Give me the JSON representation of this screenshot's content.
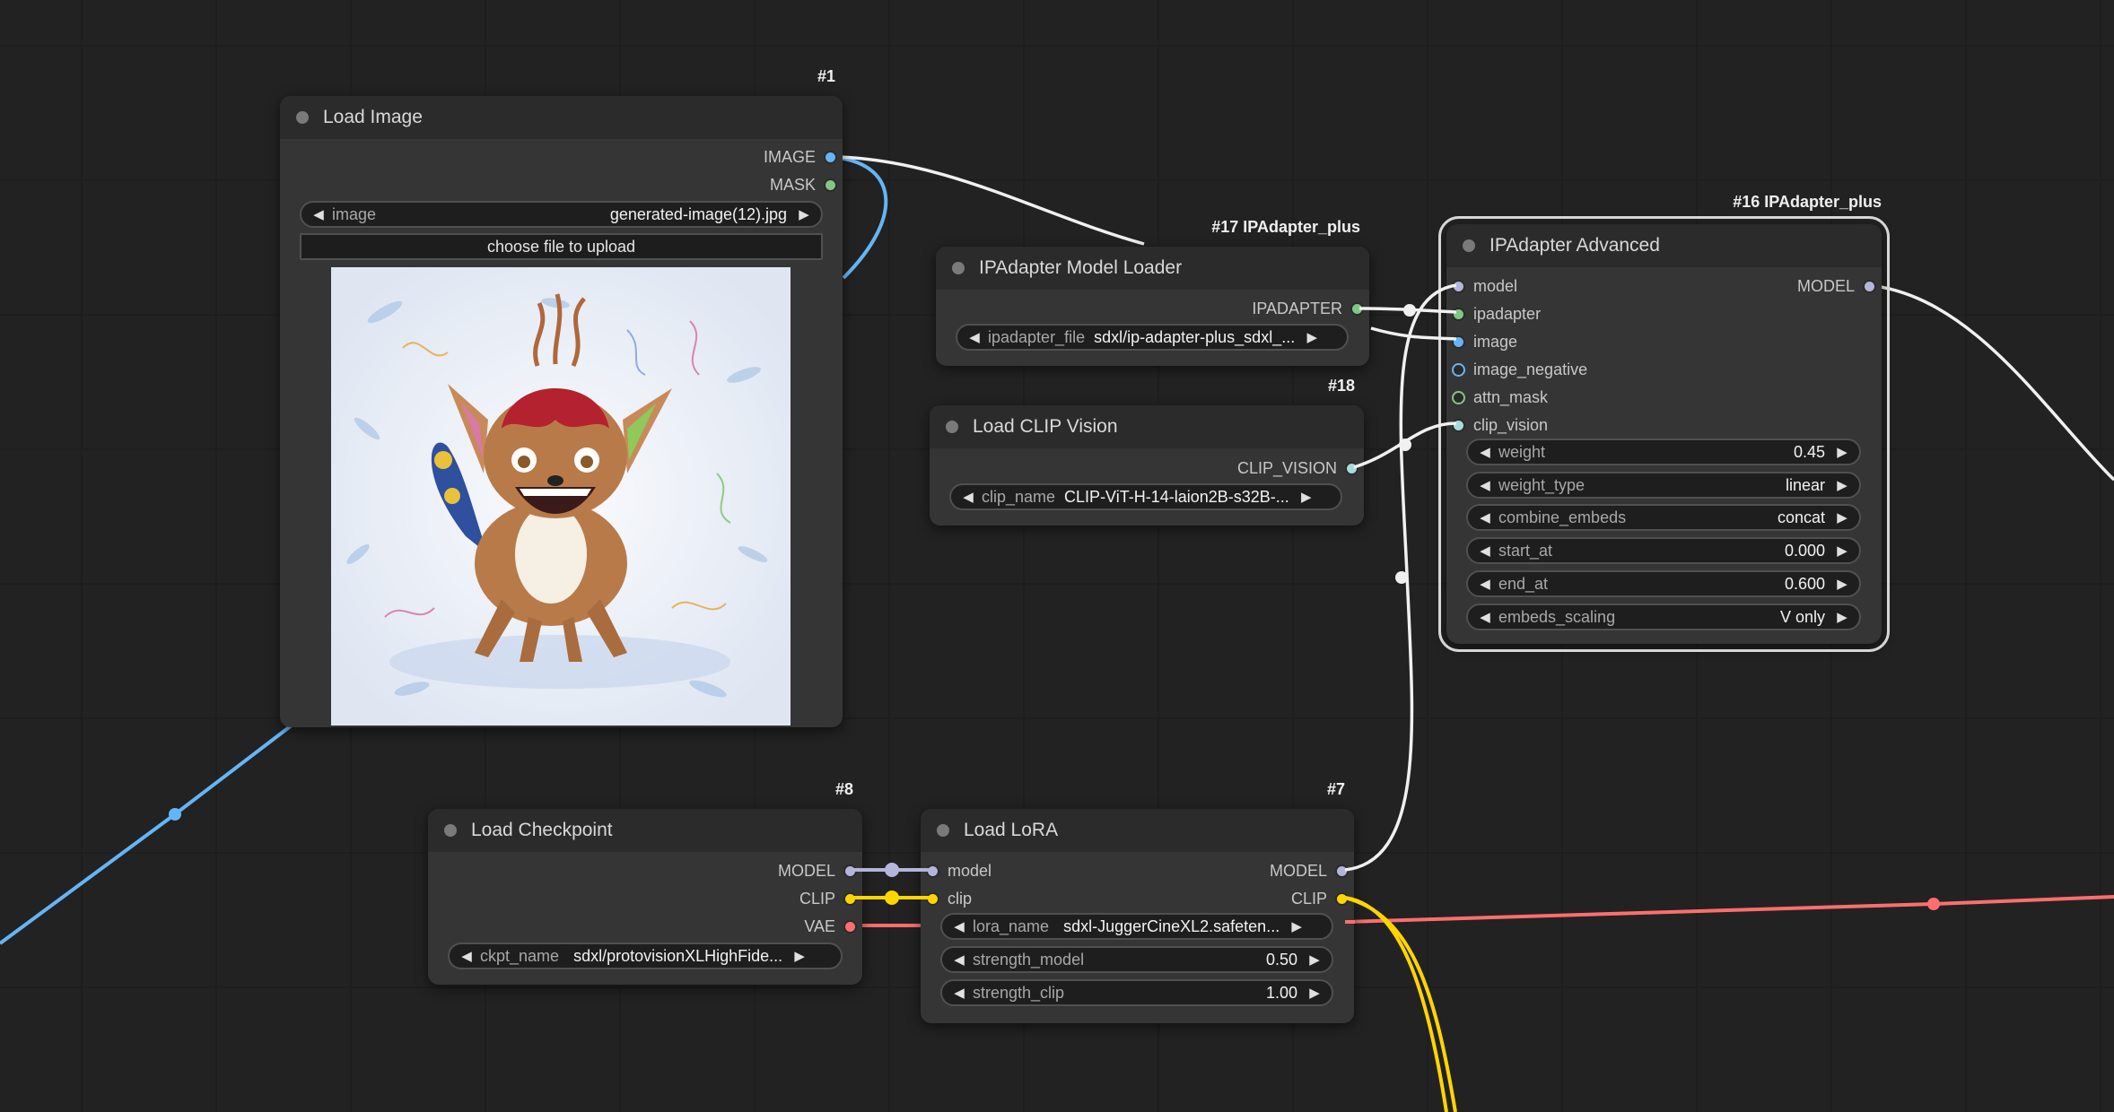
{
  "colors": {
    "canvas": "#222222",
    "node_body": "#353535",
    "node_header": "#2b2b2b",
    "wire_model": "#b4b4dc",
    "wire_clip": "#ffd500",
    "wire_vae": "#ff6e6e",
    "wire_image": "#64b5f6",
    "wire_white": "#f0f0f0",
    "slot_image": "#64b5f6",
    "slot_mask": "#81c784",
    "slot_model": "#b4b4dc",
    "slot_clip": "#ffd500",
    "slot_vae": "#ff6e6e",
    "slot_clip_vision": "#a8dadc",
    "slot_ipadapter": "#81c784"
  },
  "nodes": {
    "load_image": {
      "id_label": "#1",
      "title": "Load Image",
      "outputs": [
        "IMAGE",
        "MASK"
      ],
      "widget": {
        "label": "image",
        "value": "generated-image(12).jpg"
      },
      "button": "choose file to upload",
      "preview_icon": "creature-drawing-image"
    },
    "ipadapter_loader": {
      "id_label": "#17 IPAdapter_plus",
      "title": "IPAdapter Model Loader",
      "output": "IPADAPTER",
      "widget": {
        "label": "ipadapter_file",
        "value": "sdxl/ip-adapter-plus_sdxl_..."
      }
    },
    "clip_vision": {
      "id_label": "#18",
      "title": "Load CLIP Vision",
      "output": "CLIP_VISION",
      "widget": {
        "label": "clip_name",
        "value": "CLIP-ViT-H-14-laion2B-s32B-..."
      }
    },
    "ipadapter_advanced": {
      "id_label": "#16 IPAdapter_plus",
      "title": "IPAdapter Advanced",
      "inputs": [
        "model",
        "ipadapter",
        "image",
        "image_negative",
        "attn_mask",
        "clip_vision"
      ],
      "output": "MODEL",
      "widgets": [
        {
          "label": "weight",
          "value": "0.45"
        },
        {
          "label": "weight_type",
          "value": "linear"
        },
        {
          "label": "combine_embeds",
          "value": "concat"
        },
        {
          "label": "start_at",
          "value": "0.000"
        },
        {
          "label": "end_at",
          "value": "0.600"
        },
        {
          "label": "embeds_scaling",
          "value": "V only"
        }
      ]
    },
    "load_checkpoint": {
      "id_label": "#8",
      "title": "Load Checkpoint",
      "outputs": [
        "MODEL",
        "CLIP",
        "VAE"
      ],
      "widget": {
        "label": "ckpt_name",
        "value": "sdxl/protovisionXLHighFide..."
      }
    },
    "load_lora": {
      "id_label": "#7",
      "title": "Load LoRA",
      "inputs": [
        "model",
        "clip"
      ],
      "outputs": [
        "MODEL",
        "CLIP"
      ],
      "widgets": [
        {
          "label": "lora_name",
          "value": "sdxl-JuggerCineXL2.safeten..."
        },
        {
          "label": "strength_model",
          "value": "0.50"
        },
        {
          "label": "strength_clip",
          "value": "1.00"
        }
      ]
    }
  }
}
